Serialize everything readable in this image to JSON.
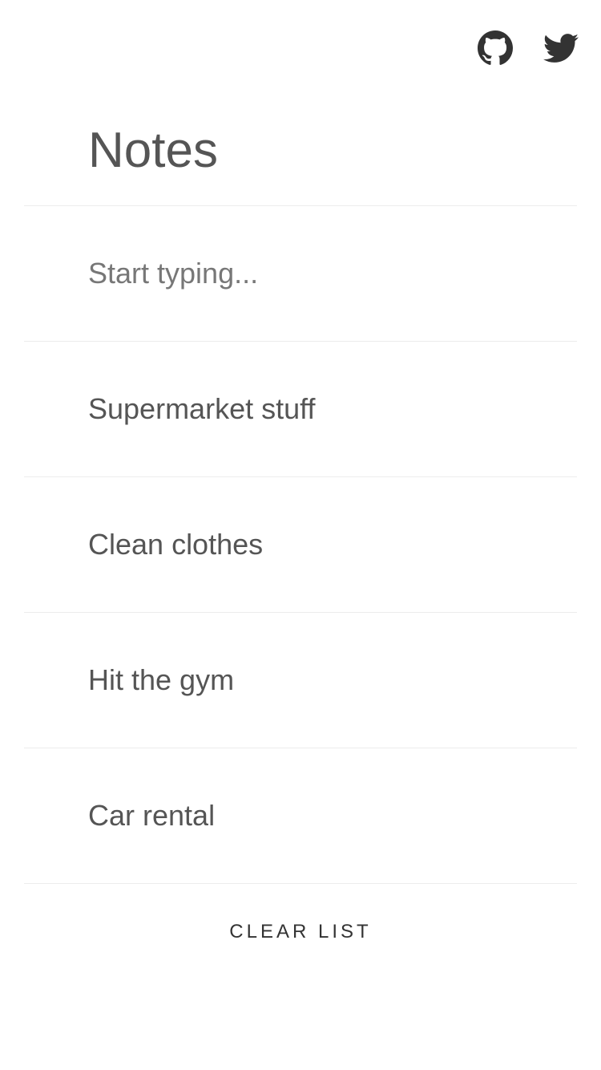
{
  "header": {
    "social": [
      {
        "name": "github",
        "icon": "github-icon"
      },
      {
        "name": "twitter",
        "icon": "twitter-icon"
      }
    ]
  },
  "page": {
    "title": "Notes"
  },
  "composer": {
    "placeholder": "Start typing..."
  },
  "notes": [
    {
      "text": "Supermarket stuff"
    },
    {
      "text": "Clean clothes"
    },
    {
      "text": "Hit the gym"
    },
    {
      "text": "Car rental"
    }
  ],
  "actions": {
    "clear_label": "CLEAR LIST"
  },
  "colors": {
    "text": "#555555",
    "icon": "#333333",
    "divider": "#ececec",
    "background": "#ffffff"
  }
}
